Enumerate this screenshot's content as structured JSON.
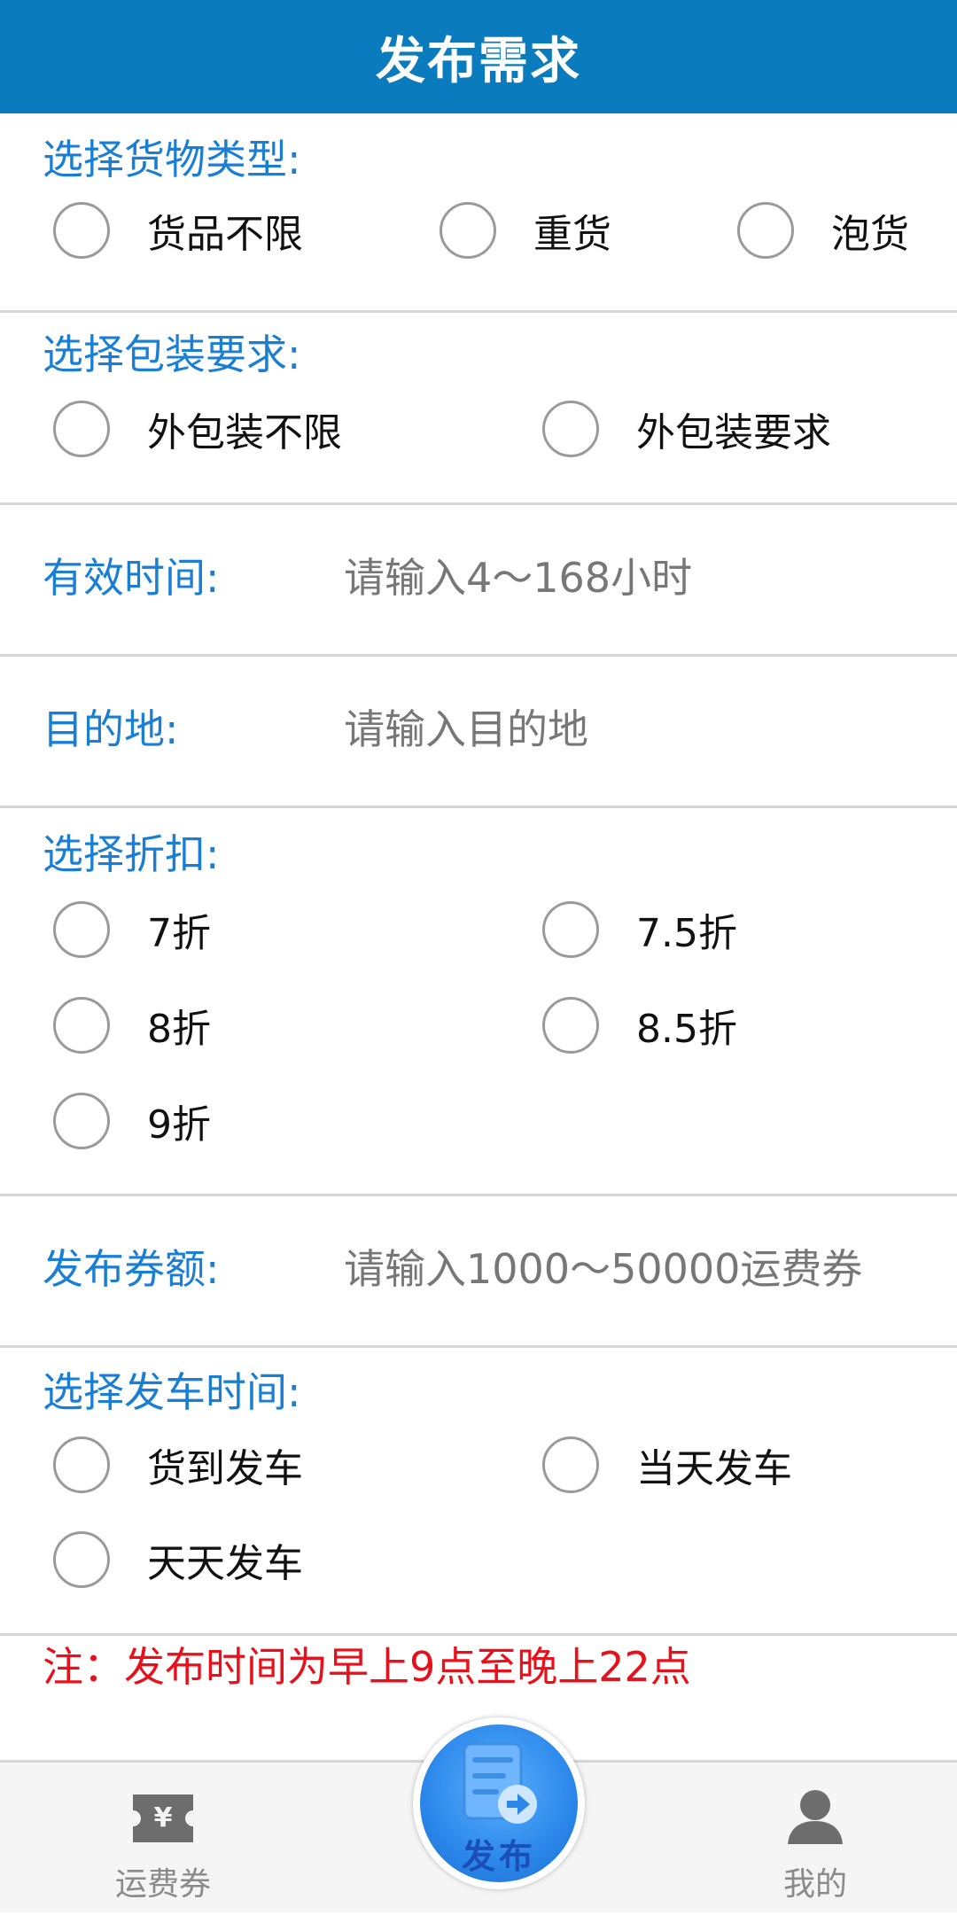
{
  "header": {
    "title": "发布需求"
  },
  "cargo_type": {
    "label": "选择货物类型:",
    "options": [
      "货品不限",
      "重货",
      "泡货"
    ]
  },
  "packaging": {
    "label": "选择包装要求:",
    "options": [
      "外包装不限",
      "外包装要求"
    ]
  },
  "valid_time": {
    "label": "有效时间:",
    "placeholder": "请输入4～168小时"
  },
  "destination": {
    "label": "目的地:",
    "placeholder": "请输入目的地"
  },
  "discount": {
    "label": "选择折扣:",
    "options": [
      "7折",
      "7.5折",
      "8折",
      "8.5折",
      "9折"
    ]
  },
  "amount": {
    "label": "发布券额:",
    "placeholder": "请输入1000～50000运费券"
  },
  "departure": {
    "label": "选择发车时间:",
    "options": [
      "货到发车",
      "当天发车",
      "天天发车"
    ]
  },
  "note": "注：发布时间为早上9点至晚上22点",
  "tabbar": {
    "left_label": "运费券",
    "center_label": "发布",
    "right_label": "我的"
  },
  "colors": {
    "header": "#0a7bbd",
    "label": "#1a7fd4",
    "note": "#e8101a"
  }
}
